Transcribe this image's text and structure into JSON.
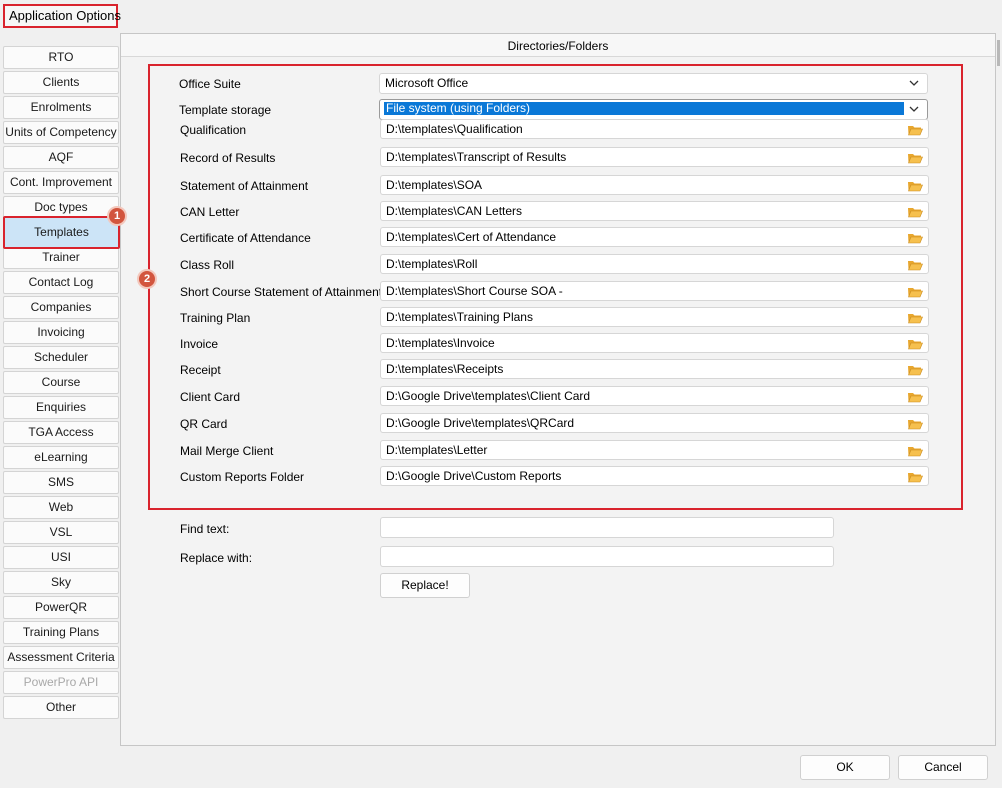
{
  "window": {
    "title": "Application Options"
  },
  "sidebar": {
    "items": [
      {
        "label": "RTO"
      },
      {
        "label": "Clients"
      },
      {
        "label": "Enrolments"
      },
      {
        "label": "Units of Competency"
      },
      {
        "label": "AQF"
      },
      {
        "label": "Cont. Improvement"
      },
      {
        "label": "Doc types"
      },
      {
        "label": "Templates",
        "active": true
      },
      {
        "label": "Trainer"
      },
      {
        "label": "Contact Log"
      },
      {
        "label": "Companies"
      },
      {
        "label": "Invoicing"
      },
      {
        "label": "Scheduler"
      },
      {
        "label": "Course"
      },
      {
        "label": "Enquiries"
      },
      {
        "label": "TGA Access"
      },
      {
        "label": "eLearning"
      },
      {
        "label": "SMS"
      },
      {
        "label": "Web"
      },
      {
        "label": "VSL"
      },
      {
        "label": "USI"
      },
      {
        "label": "Sky"
      },
      {
        "label": "PowerQR"
      },
      {
        "label": "Training Plans"
      },
      {
        "label": "Assessment Criteria"
      },
      {
        "label": "PowerPro API",
        "disabled": true
      },
      {
        "label": "Other"
      }
    ]
  },
  "annotations": {
    "badge_1": "1",
    "badge_2": "2"
  },
  "panel": {
    "header": "Directories/Folders",
    "office_suite": {
      "label": "Office Suite",
      "value": "Microsoft Office"
    },
    "template_storage": {
      "label": "Template storage",
      "value": "File system (using Folders)"
    },
    "folders": [
      {
        "label": "Qualification",
        "path": "D:\\templates\\Qualification"
      },
      {
        "label": "Record of Results",
        "path": "D:\\templates\\Transcript of Results"
      },
      {
        "label": "Statement of Attainment",
        "path": "D:\\templates\\SOA"
      },
      {
        "label": "CAN Letter",
        "path": "D:\\templates\\CAN Letters"
      },
      {
        "label": "Certificate of Attendance",
        "path": "D:\\templates\\Cert of Attendance"
      },
      {
        "label": "Class Roll",
        "path": "D:\\templates\\Roll"
      },
      {
        "label": "Short Course Statement of Attainment",
        "path": "D:\\templates\\Short Course SOA -"
      },
      {
        "label": "Training Plan",
        "path": "D:\\templates\\Training Plans"
      },
      {
        "label": "Invoice",
        "path": "D:\\templates\\Invoice"
      },
      {
        "label": "Receipt",
        "path": "D:\\templates\\Receipts"
      },
      {
        "label": "Client Card",
        "path": "D:\\Google Drive\\templates\\Client Card"
      },
      {
        "label": "QR Card",
        "path": "D:\\Google Drive\\templates\\QRCard"
      },
      {
        "label": "Mail Merge Client",
        "path": "D:\\templates\\Letter"
      },
      {
        "label": "Custom Reports Folder",
        "path": "D:\\Google Drive\\Custom Reports"
      }
    ],
    "find_text": {
      "label": "Find text:",
      "value": ""
    },
    "replace_with": {
      "label": "Replace with:",
      "value": ""
    },
    "replace_button": "Replace!"
  },
  "footer": {
    "ok": "OK",
    "cancel": "Cancel"
  },
  "colors": {
    "annotation_red": "#d9232d",
    "selection_blue": "#0a78d7",
    "active_nav": "#cce4f7"
  }
}
